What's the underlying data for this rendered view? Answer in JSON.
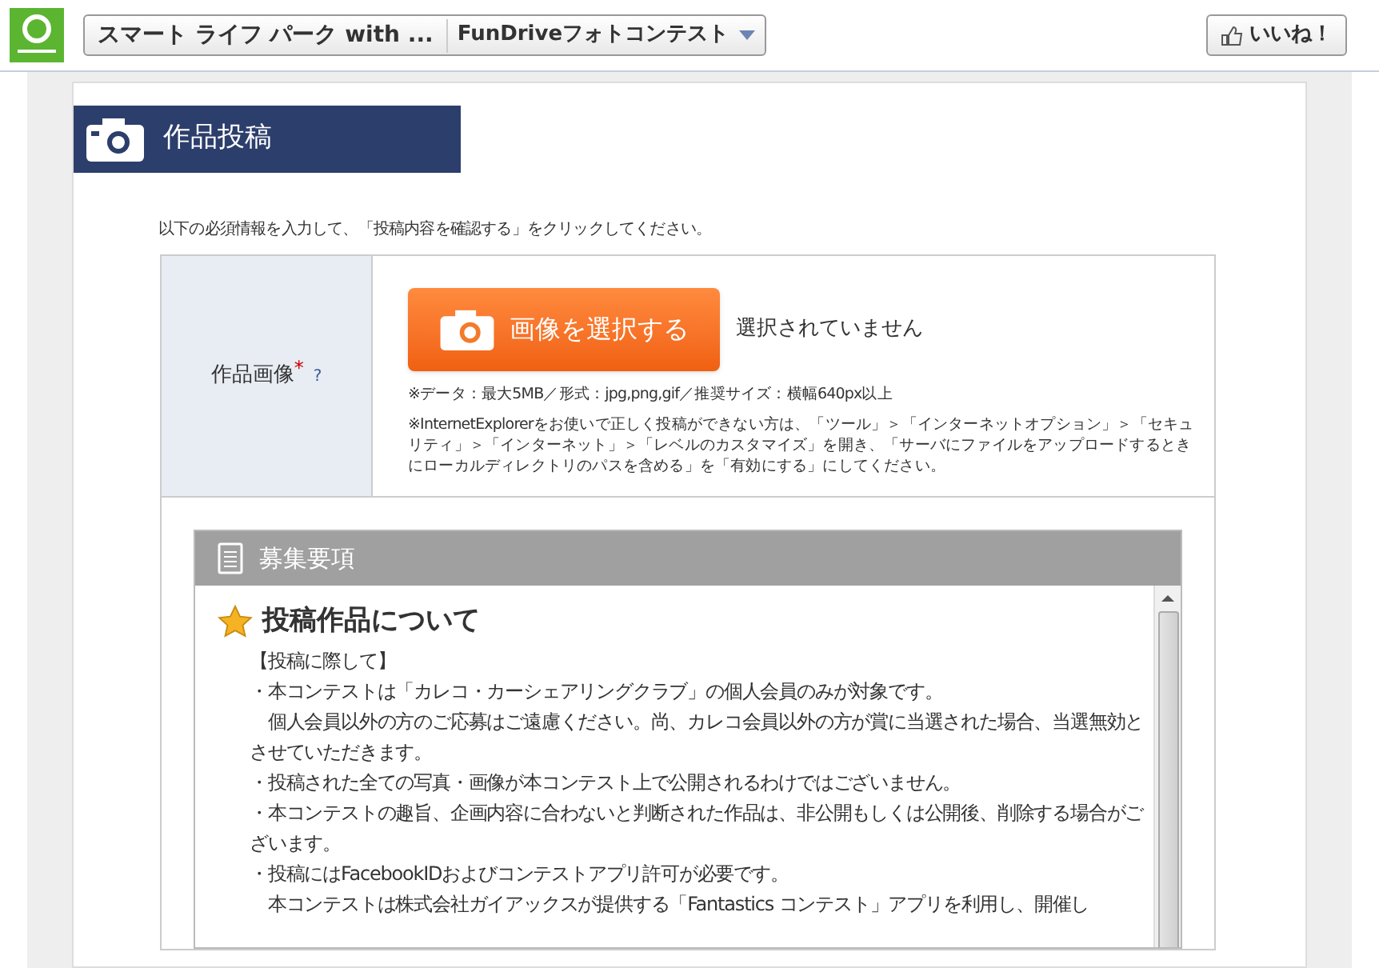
{
  "top_bar": {
    "breadcrumb": [
      "スマート ライフ パーク with ...",
      "FunDriveフォトコンテスト"
    ],
    "like_button": "いいね！"
  },
  "section_title": "作品投稿",
  "instruction": "以下の必須情報を入力して、「投稿内容を確認する」をクリックしてください。",
  "form": {
    "label": "作品画像",
    "required_mark": "*",
    "help": "?",
    "select_button": "画像を選択する",
    "file_status": "選択されていません",
    "notes": [
      "※データ：最大5MB／形式：jpg,png,gif／推奨サイズ：横幅640px以上",
      "※InternetExplorerをお使いで正しく投稿ができない方は、「ツール」＞「インターネットオプション」＞「セキュリティ」＞「インターネット」＞「レベルのカスタマイズ」を開き、「サーバにファイルをアップロードするときにローカルディレクトリのパスを含める」を「有効にする」にしてください。"
    ]
  },
  "guidelines": {
    "title": "募集要項",
    "heading": "投稿作品について",
    "paragraphs": [
      "【投稿に際して】",
      "・本コンテストは「カレコ・カーシェアリングクラブ」の個人会員のみが対象です。",
      "　個人会員以外の方のご応募はご遠慮ください。尚、カレコ会員以外の方が賞に当選された場合、当選無効とさせていただきます。",
      "・投稿された全ての写真・画像が本コンテスト上で公開されるわけではございません。",
      "・本コンテストの趣旨、企画内容に合わないと判断された作品は、非公開もしくは公開後、削除する場合がございます。",
      "・投稿にはFacebookIDおよびコンテストアプリ許可が必要です。",
      "　本コンテストは株式会社ガイアックスが提供する「Fantastics コンテスト」アプリを利用し、開催し"
    ]
  }
}
